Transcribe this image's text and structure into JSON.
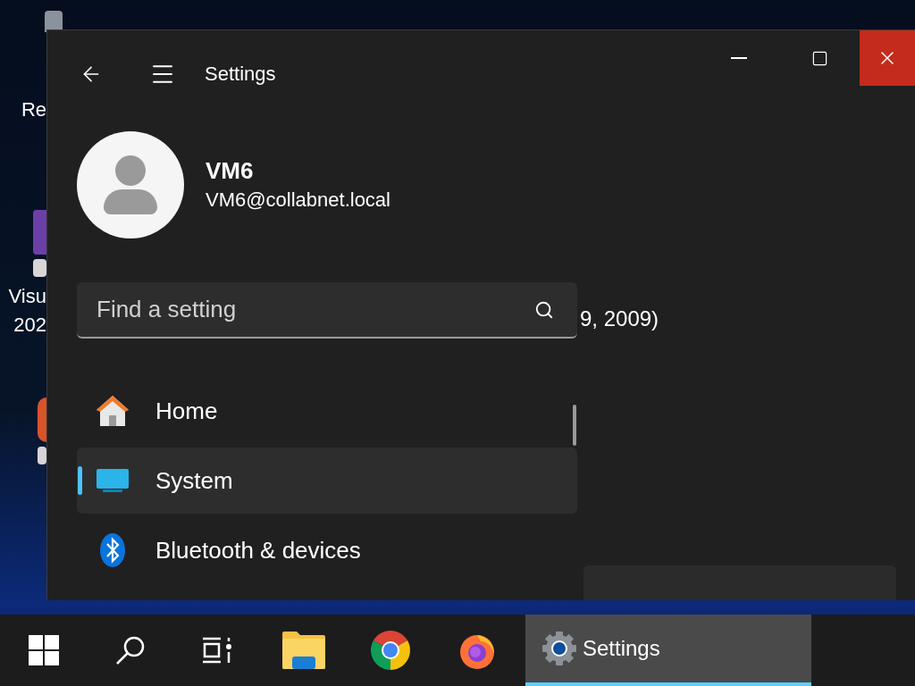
{
  "desktop": {
    "icons": [
      {
        "kind": "bin",
        "lines": [
          "Re"
        ]
      },
      {
        "kind": "studio",
        "lines": [
          "Visu",
          "202"
        ]
      },
      {
        "kind": "orange"
      }
    ]
  },
  "window": {
    "title": "Settings",
    "user": {
      "name": "VM6",
      "email": "VM6@collabnet.local"
    },
    "search": {
      "placeholder": "Find a setting"
    },
    "nav": [
      {
        "kind": "home",
        "label": "Home",
        "selected": false
      },
      {
        "kind": "system",
        "label": "System",
        "selected": true
      },
      {
        "kind": "bluetooth",
        "label": "Bluetooth & devices",
        "selected": false
      }
    ],
    "content": {
      "text": "9, 2009)"
    }
  },
  "taskbar": {
    "items": [
      {
        "kind": "start",
        "selected": false
      },
      {
        "kind": "search",
        "selected": false
      },
      {
        "kind": "taskview",
        "selected": false
      },
      {
        "kind": "explorer",
        "selected": false
      },
      {
        "kind": "chrome",
        "selected": false
      },
      {
        "kind": "firefox",
        "selected": false
      },
      {
        "kind": "settings",
        "label": "Settings",
        "selected": true
      }
    ]
  }
}
